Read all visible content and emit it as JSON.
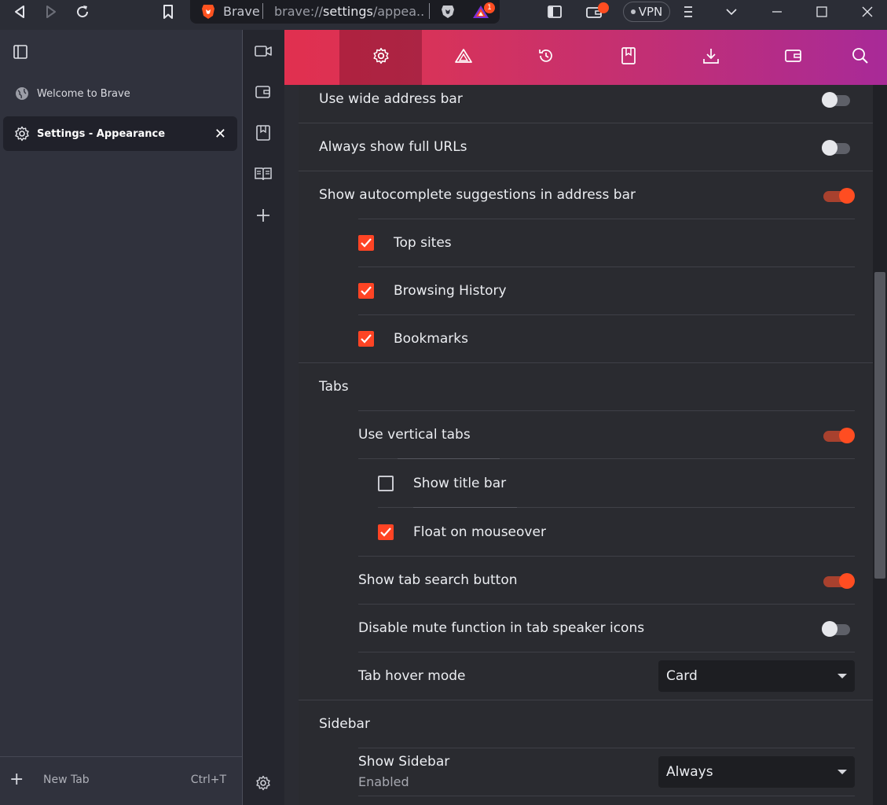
{
  "toolbar": {
    "tab_site": "Brave",
    "url_scheme": "brave://",
    "url_host": "settings",
    "url_rest": "/appea...",
    "rewards_badge": "1",
    "vpn_label": "VPN"
  },
  "tabs": [
    {
      "label": "Welcome to Brave",
      "icon": "globe-icon",
      "active": false
    },
    {
      "label": "Settings - Appearance",
      "icon": "gear-icon",
      "active": true
    }
  ],
  "new_tab": {
    "label": "New Tab",
    "shortcut": "Ctrl+T"
  },
  "settings_nav": [
    "gear-icon",
    "brave-rewards-icon",
    "history-icon",
    "bookmarks-icon",
    "downloads-icon",
    "wallet-icon",
    "search-icon"
  ],
  "address_bar": {
    "wide_address_bar": "Use wide address bar",
    "full_urls": "Always show full URLs",
    "autocomplete": "Show autocomplete suggestions in address bar",
    "top_sites": "Top sites",
    "browsing_history": "Browsing History",
    "bookmarks": "Bookmarks"
  },
  "tabs_section": {
    "title": "Tabs",
    "vertical_tabs": "Use vertical tabs",
    "show_title_bar": "Show title bar",
    "float_on_mouseover": "Float on mouseover",
    "tab_search_button": "Show tab search button",
    "disable_mute": "Disable mute function in tab speaker icons",
    "hover_mode_label": "Tab hover mode",
    "hover_mode_value": "Card"
  },
  "sidebar_section": {
    "title": "Sidebar",
    "show_sidebar": "Show Sidebar",
    "show_sidebar_sub": "Enabled",
    "show_sidebar_value": "Always"
  },
  "colors": {
    "accent": "#ff4d21",
    "bar_gradient_start": "#e1304f",
    "bar_gradient_end": "#a82a98"
  }
}
